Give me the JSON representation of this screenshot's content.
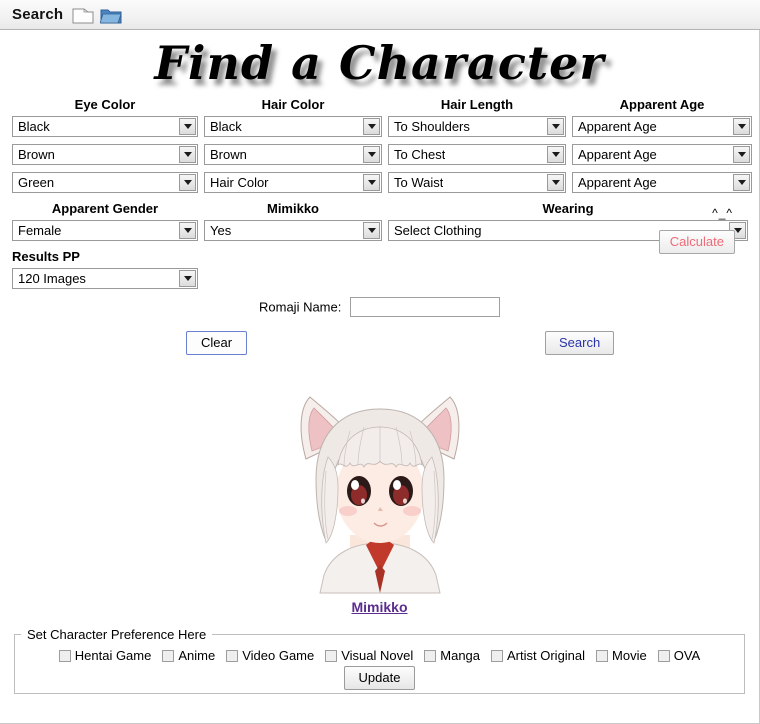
{
  "app_bar": {
    "title": "Search",
    "icons": [
      "new-document-icon",
      "open-folder-icon"
    ]
  },
  "banner": {
    "title": "Find a Character"
  },
  "form": {
    "columns": [
      {
        "label": "Eye Color",
        "name": "eye-color",
        "selects": [
          {
            "value": "Black"
          },
          {
            "value": "Brown"
          },
          {
            "value": "Green"
          }
        ]
      },
      {
        "label": "Hair Color",
        "name": "hair-color",
        "selects": [
          {
            "value": "Black"
          },
          {
            "value": "Brown"
          },
          {
            "value": "Hair Color"
          }
        ]
      },
      {
        "label": "Hair Length",
        "name": "hair-length",
        "selects": [
          {
            "value": "To Shoulders"
          },
          {
            "value": "To Chest"
          },
          {
            "value": "To Waist"
          }
        ]
      },
      {
        "label": "Apparent Age",
        "name": "apparent-age",
        "selects": [
          {
            "value": "Apparent Age"
          },
          {
            "value": "Apparent Age"
          },
          {
            "value": "Apparent Age"
          }
        ]
      }
    ],
    "row2": {
      "gender": {
        "label": "Apparent Gender",
        "value": "Female"
      },
      "mimikko": {
        "label": "Mimikko",
        "value": "Yes"
      },
      "wearing": {
        "label": "Wearing",
        "value": "Select Clothing"
      }
    },
    "results_pp": {
      "label": "Results PP",
      "value": "120 Images"
    },
    "emoticon": "^_^",
    "calculate_label": "Calculate",
    "romaji": {
      "label": "Romaji Name:",
      "value": "",
      "placeholder": ""
    },
    "clear_label": "Clear",
    "search_label": "Search"
  },
  "result": {
    "character_name": "Mimikko",
    "image_alt": "anime-cat-girl-portrait"
  },
  "preferences": {
    "legend": "Set Character Preference Here",
    "options": [
      {
        "label": "Hentai Game",
        "checked": false
      },
      {
        "label": "Anime",
        "checked": false
      },
      {
        "label": "Video Game",
        "checked": false
      },
      {
        "label": "Visual Novel",
        "checked": false
      },
      {
        "label": "Manga",
        "checked": false
      },
      {
        "label": "Artist Original",
        "checked": false
      },
      {
        "label": "Movie",
        "checked": false
      },
      {
        "label": "OVA",
        "checked": false
      }
    ],
    "update_label": "Update"
  },
  "colors": {
    "calculate_text": "#ef6a78",
    "search_text": "#2b33a8",
    "link": "#5b2d8e",
    "clear_border": "#6a7fcf"
  }
}
